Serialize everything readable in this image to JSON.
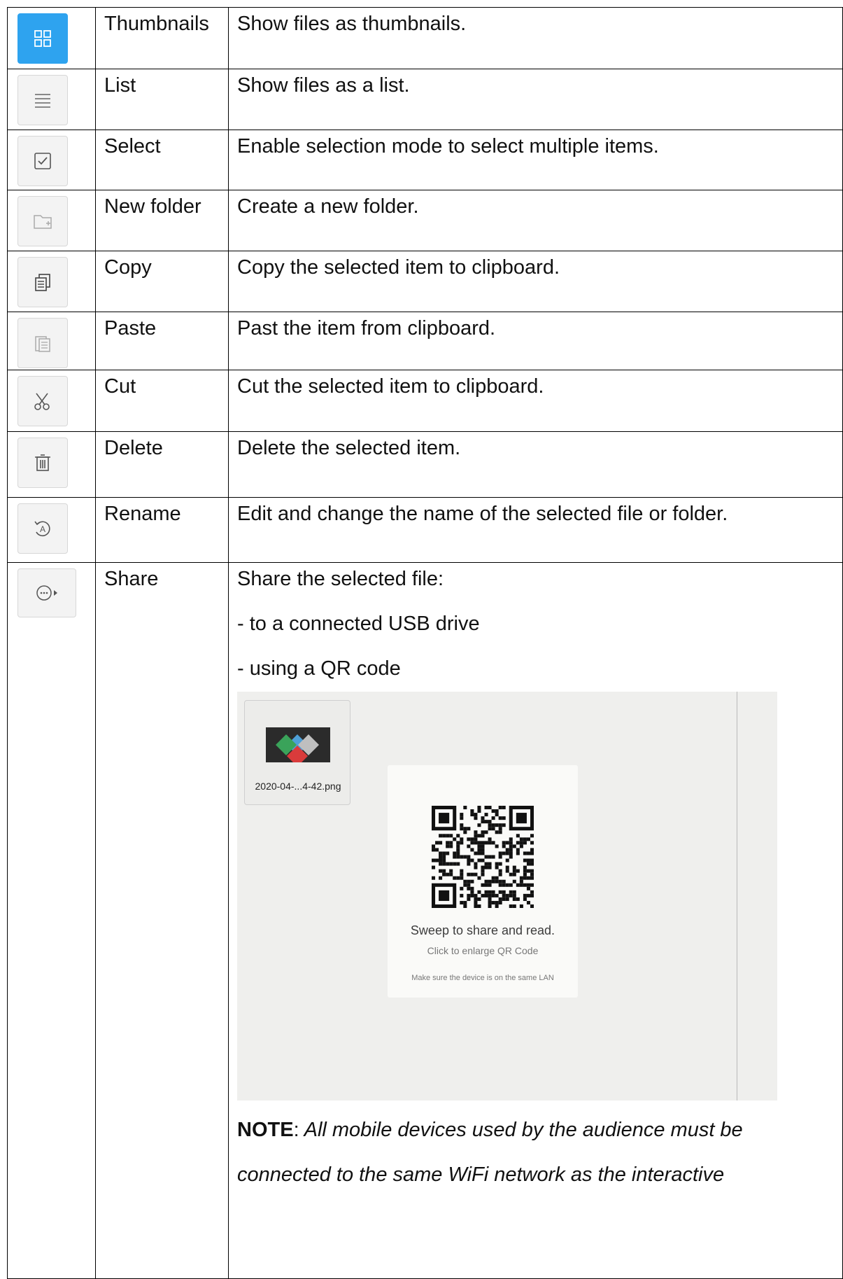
{
  "rows": [
    {
      "icon": "thumbnails-grid-icon",
      "name": "Thumbnails",
      "desc": "Show files as thumbnails."
    },
    {
      "icon": "list-icon",
      "name": "List",
      "desc": "Show files as a list."
    },
    {
      "icon": "checkbox-icon",
      "name": "Select",
      "desc": "Enable selection mode to select multiple items."
    },
    {
      "icon": "new-folder-icon",
      "name": "New folder",
      "desc": "Create a new folder."
    },
    {
      "icon": "copy-icon",
      "name": "Copy",
      "desc": "Copy the selected item to clipboard."
    },
    {
      "icon": "paste-icon",
      "name": "Paste",
      "desc": "Past the item from clipboard."
    },
    {
      "icon": "scissors-icon",
      "name": "Cut",
      "desc": "Cut the selected item to clipboard."
    },
    {
      "icon": "trash-icon",
      "name": "Delete",
      "desc": "Delete the selected item."
    },
    {
      "icon": "rename-icon",
      "name": "Rename",
      "desc": "Edit and change the name of the selected file or folder."
    }
  ],
  "share": {
    "icon": "share-more-icon",
    "name": "Share",
    "intro": "Share the selected file:",
    "options": [
      "- to a connected USB drive",
      "- using a QR code"
    ],
    "panel": {
      "file_name": "2020-04-...4-42.png",
      "qr_title": "Sweep to share and read.",
      "qr_subtitle": "Click to enlarge QR Code",
      "qr_lan_note": "Make sure the device is on the same LAN"
    },
    "note_label": "NOTE",
    "note_sep": ":",
    "note_line1": " All mobile devices used by the audience must be",
    "note_line2": "connected to the same WiFi network as the interactive"
  },
  "colors": {
    "active_button": "#2ea3ef",
    "button_bg": "#f3f3f3",
    "border": "#000000"
  }
}
